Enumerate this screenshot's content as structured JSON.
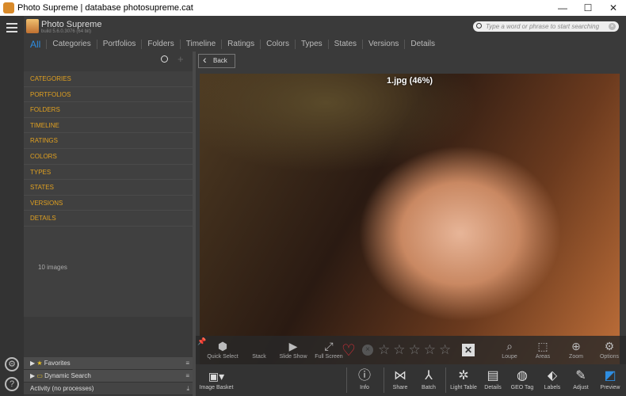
{
  "window": {
    "title": "Photo Supreme | database photosupreme.cat"
  },
  "header": {
    "brand": "Photo Supreme",
    "build": "build 5.6.0.3076 (64 bit)",
    "search_placeholder": "Type a word or phrase to start searching",
    "tabs": [
      "All",
      "Categories",
      "Portfolios",
      "Folders",
      "Timeline",
      "Ratings",
      "Colors",
      "Types",
      "States",
      "Versions",
      "Details"
    ]
  },
  "left_panel": {
    "categories": [
      "CATEGORIES",
      "PORTFOLIOS",
      "FOLDERS",
      "TIMELINE",
      "RATINGS",
      "COLORS",
      "TYPES",
      "STATES",
      "VERSIONS",
      "DETAILS"
    ],
    "image_count": "10 images",
    "favorites_label": "Favorites",
    "dynamic_search_label": "Dynamic Search",
    "activity_label": "Activity (no processes)"
  },
  "viewer": {
    "back_label": "Back",
    "caption": "1.jpg (46%)",
    "rating_stars": 0,
    "overlay": {
      "quick_select": "Quick Select",
      "stack": "Stack",
      "slide_show": "Slide Show",
      "full_screen": "Full Screen",
      "loupe": "Loupe",
      "areas": "Areas",
      "zoom": "Zoom",
      "options": "Options"
    }
  },
  "toolbar": {
    "image_basket": "Image Basket",
    "info": "Info",
    "share": "Share",
    "batch": "Batch",
    "light_table": "Light Table",
    "details": "Details",
    "geo_tag": "GEO Tag",
    "labels": "Labels",
    "adjust": "Adjust",
    "preview": "Preview"
  },
  "colors": {
    "accent": "#2e8de0",
    "category_text": "#e0a020",
    "favorite_heart": "#e0303a"
  }
}
